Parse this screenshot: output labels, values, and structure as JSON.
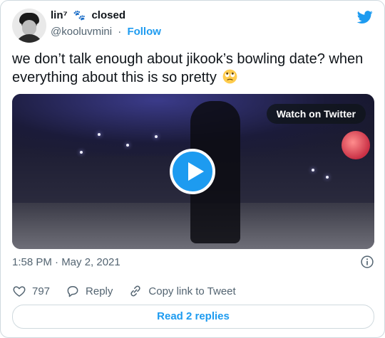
{
  "author": {
    "display_name": "lin⁷",
    "name_emoji": "🐾",
    "name_suffix": "closed",
    "handle": "@kooluvmini",
    "separator": "·",
    "follow_label": "Follow"
  },
  "tweet": {
    "text": "we don’t talk enough about jikook’s bowling date? when everything about this is so pretty"
  },
  "media": {
    "watch_label": "Watch on Twitter"
  },
  "meta": {
    "timestamp": "1:58 PM · May 2, 2021"
  },
  "actions": {
    "like_count": "797",
    "reply_label": "Reply",
    "copy_label": "Copy link to Tweet"
  },
  "footer": {
    "replies_label": "Read 2 replies"
  },
  "colors": {
    "accent": "#1d9bf0",
    "muted": "#536471",
    "border": "#cfd9de"
  },
  "icons": [
    "twitter-bird-icon",
    "play-icon",
    "info-icon",
    "heart-icon",
    "reply-icon",
    "link-icon",
    "rolling-eyes-emoji"
  ]
}
